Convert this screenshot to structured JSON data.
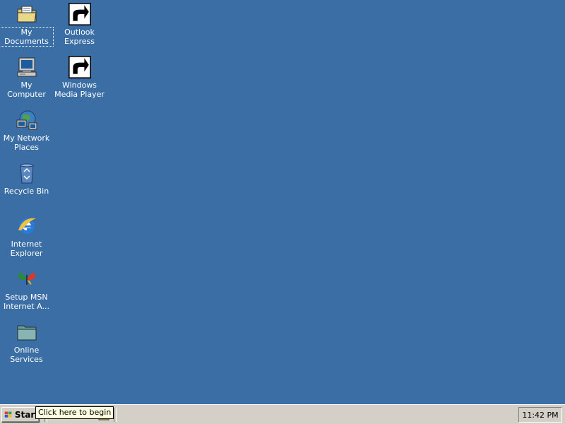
{
  "desktop": {
    "background_color": "#3a6ea5",
    "icons": [
      {
        "label": "My Documents",
        "icon": "folder-documents-icon"
      },
      {
        "label": "My Computer",
        "icon": "computer-icon"
      },
      {
        "label": "My Network Places",
        "icon": "network-places-icon"
      },
      {
        "label": "Recycle Bin",
        "icon": "recycle-bin-icon"
      },
      {
        "label": "Internet Explorer",
        "icon": "internet-explorer-icon"
      },
      {
        "label": "Setup MSN Internet A...",
        "icon": "msn-butterfly-icon"
      },
      {
        "label": "Online Services",
        "icon": "folder-icon"
      },
      {
        "label": "Outlook Express",
        "icon": "outlook-express-icon"
      },
      {
        "label": "Windows Media Player",
        "icon": "media-player-icon"
      }
    ]
  },
  "taskbar": {
    "start_label": "Start",
    "quick_launch": [
      "show-desktop-icon",
      "internet-explorer-icon",
      "outlook-express-icon",
      "media-player-icon"
    ],
    "clock": "11:42 PM"
  },
  "tooltip": {
    "text": "Click here to begin"
  }
}
